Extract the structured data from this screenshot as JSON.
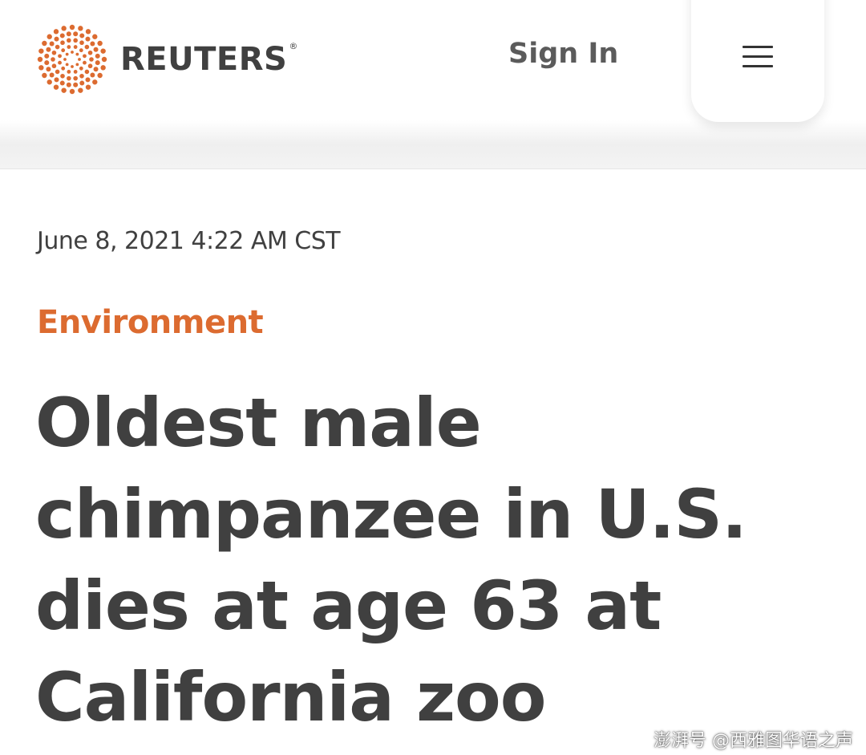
{
  "header": {
    "brand": "REUTERS",
    "brand_mark": "®",
    "sign_in_label": "Sign In",
    "menu_icon": "hamburger-menu-icon"
  },
  "article": {
    "dateline": "June 8, 2021 4:22 AM CST",
    "section": "Environment",
    "headline": "Oldest male chimpanzee in U.S. dies at age 63 at California zoo"
  },
  "watermark": {
    "text": "澎湃号 @西雅图华语之声"
  },
  "colors": {
    "brand_orange": "#dc6b30",
    "text_dark": "#404040",
    "sign_in_gray": "#5b5b5b"
  }
}
